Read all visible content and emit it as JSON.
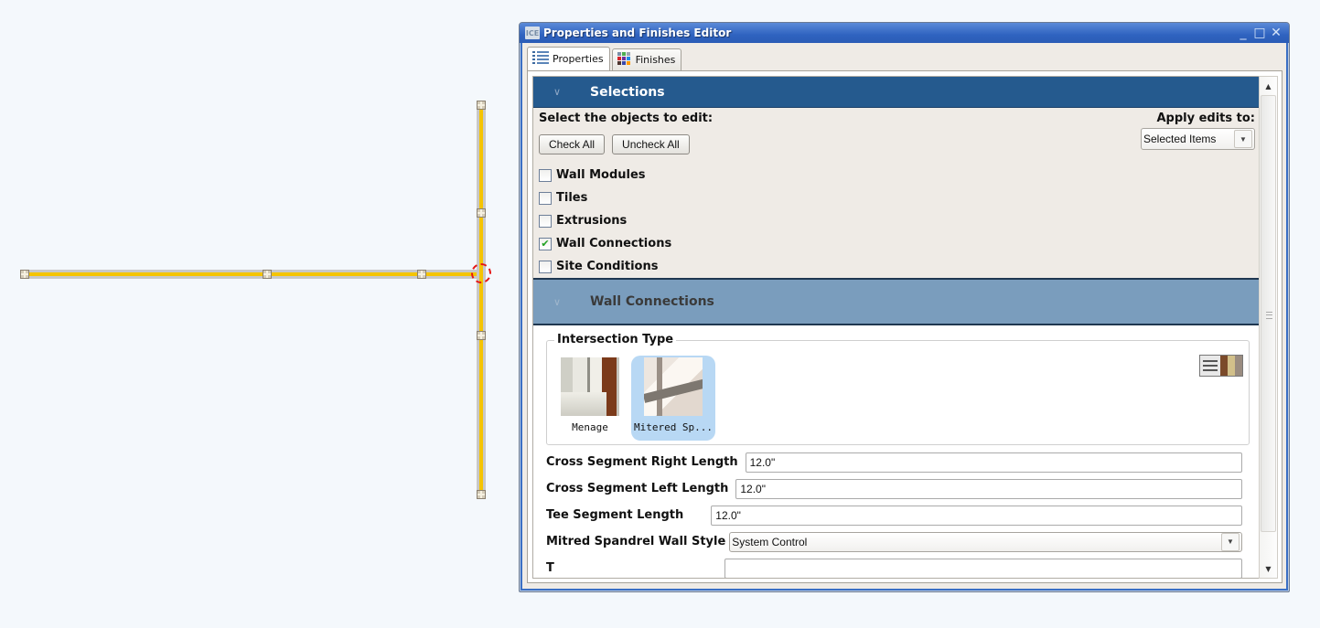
{
  "window": {
    "title": "Properties and Finishes Editor",
    "app_icon_text": "ICE",
    "controls": {
      "minimize": "_",
      "maximize": "□",
      "close": "✕"
    }
  },
  "tabs": [
    {
      "label": "Properties",
      "icon": "list-icon",
      "active": true
    },
    {
      "label": "Finishes",
      "icon": "color-grid-icon",
      "active": false
    }
  ],
  "selections": {
    "header": "Selections",
    "prompt": "Select the objects to edit:",
    "check_all_label": "Check All",
    "uncheck_all_label": "Uncheck All",
    "apply_label": "Apply edits to:",
    "apply_value": "Selected Items",
    "items": [
      {
        "label": "Wall Modules",
        "checked": false
      },
      {
        "label": "Tiles",
        "checked": false
      },
      {
        "label": "Extrusions",
        "checked": false
      },
      {
        "label": "Wall Connections",
        "checked": true
      },
      {
        "label": "Site Conditions",
        "checked": false
      }
    ]
  },
  "wall_connections": {
    "header": "Wall Connections",
    "intersection_type_label": "Intersection Type",
    "types": [
      {
        "caption": "Menage",
        "selected": false
      },
      {
        "caption": "Mitered Sp...",
        "selected": true
      }
    ],
    "properties": [
      {
        "label": "Cross Segment Right Length",
        "value": "12.0\"",
        "kind": "input"
      },
      {
        "label": "Cross Segment Left Length",
        "value": "12.0\"",
        "kind": "input"
      },
      {
        "label": "Tee Segment Length",
        "value": "12.0\"",
        "kind": "input"
      },
      {
        "label": "Mitred Spandrel Wall Style",
        "value": "System Control",
        "kind": "select"
      },
      {
        "label": "T",
        "value": "",
        "kind": "input"
      }
    ]
  },
  "glyphs": {
    "chevron": "∨",
    "checkmark": "✔",
    "dropdown": "▼",
    "scroll_up": "▲",
    "scroll_down": "▼"
  },
  "colors": {
    "selections_header": "#255a8e",
    "wall_connections_header": "#7a9dbd",
    "wall_core": "#f5c400",
    "selection_marker": "#e51515",
    "selected_tile": "#b8d8f4"
  }
}
